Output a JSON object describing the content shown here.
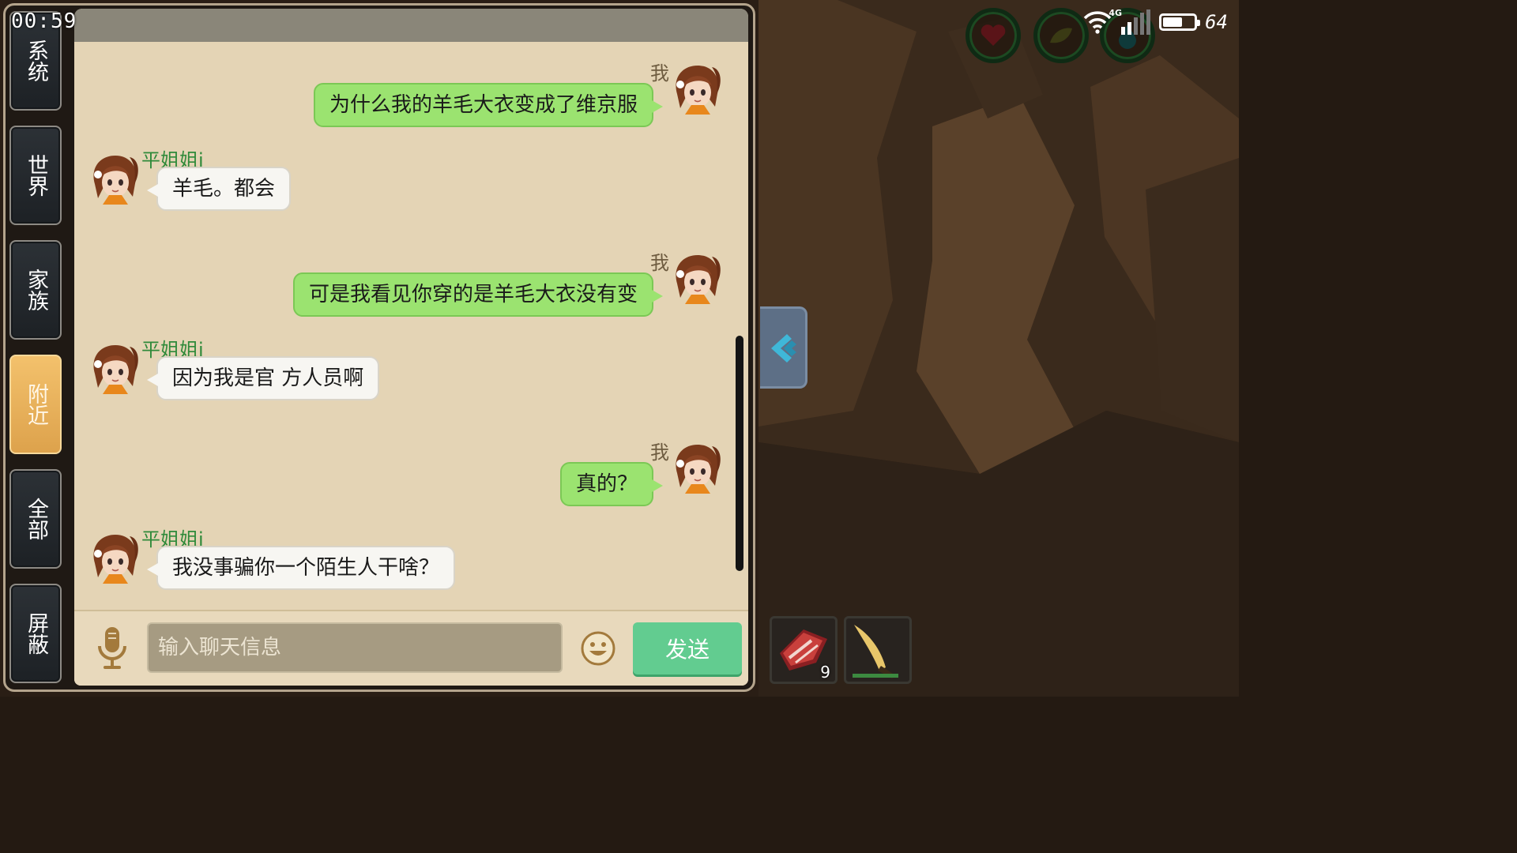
{
  "status_bar": {
    "time": "00:59",
    "network": "4G",
    "battery": "64",
    "battery_level": 0.64
  },
  "sidebar": {
    "tabs": [
      {
        "label": "系统",
        "active": false
      },
      {
        "label": "世界",
        "active": false
      },
      {
        "label": "家族",
        "active": false
      },
      {
        "label": "附近",
        "active": true
      },
      {
        "label": "全部",
        "active": false
      },
      {
        "label": "屏蔽",
        "active": false
      }
    ]
  },
  "messages": [
    {
      "sender": "me",
      "name": "我",
      "text": "为什么我的羊毛大衣变成了维京服"
    },
    {
      "sender": "other",
      "name": "平姐姐i",
      "text": "羊毛。都会"
    },
    {
      "sender": "me",
      "name": "我",
      "text": "可是我看见你穿的是羊毛大衣没有变"
    },
    {
      "sender": "other",
      "name": "平姐姐i",
      "text": "因为我是官 方人员啊"
    },
    {
      "sender": "me",
      "name": "我",
      "text": "真的？"
    },
    {
      "sender": "other",
      "name": "平姐姐i",
      "text": "我没事骗你一个陌生人干啥？"
    }
  ],
  "input_bar": {
    "placeholder": "输入聊天信息",
    "send_label": "发送",
    "mic_icon": "microphone-icon",
    "emoji_icon": "smiley-icon"
  },
  "inventory": {
    "slots": [
      {
        "item_icon": "raw-meat-icon",
        "count": "9"
      },
      {
        "item_icon": "bone-knife-icon",
        "count": ""
      }
    ]
  },
  "hud": {
    "icons": [
      "heart-icon",
      "stamina-leaf-icon",
      "water-drop-icon"
    ]
  },
  "colors": {
    "my_bubble": "#9be370",
    "other_bubble": "#f7f6f2",
    "active_tab": "#e9b25c",
    "send_button": "#62cc90",
    "panel_bg": "#e4d4b5"
  }
}
